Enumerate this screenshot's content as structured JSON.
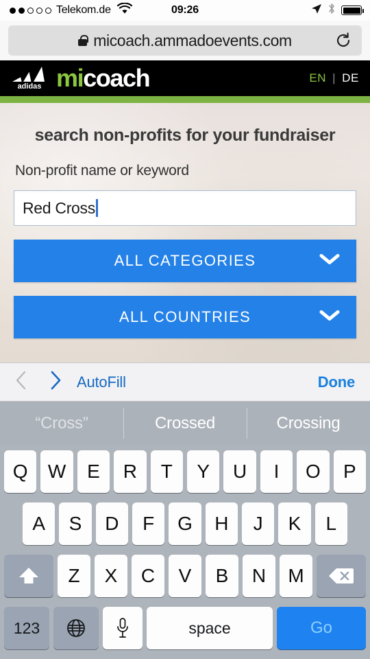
{
  "statusbar": {
    "carrier": "Telekom.de",
    "signal_dots_filled": 2,
    "signal_dots_total": 5,
    "wifi_icon": "wifi-icon",
    "time": "09:26",
    "location_icon": "location-arrow-icon",
    "bluetooth_icon": "bluetooth-icon",
    "battery_icon": "battery-full-icon",
    "battery_level": 100
  },
  "browser": {
    "lock_icon": "lock-icon",
    "url": "micoach.ammadoevents.com",
    "reload_icon": "reload-icon"
  },
  "site_header": {
    "logo_name": "adidas",
    "brand_mi": "mi",
    "brand_coach": "coach",
    "lang_en": "EN",
    "lang_separator": "|",
    "lang_de": "DE",
    "accent_green": "#8cc63f",
    "bar_green": "#7cb342"
  },
  "page": {
    "headline": "search non-profits for your fundraiser",
    "field_label": "Non-profit name or keyword",
    "search_value": "Red Cross",
    "search_placeholder": "Non-profit name or keyword",
    "dropdowns": [
      {
        "label": "ALL CATEGORIES",
        "chevron": "chevron-down-icon"
      },
      {
        "label": "ALL COUNTRIES",
        "chevron": "chevron-down-icon"
      }
    ],
    "button_blue": "#2481e8"
  },
  "accessory_bar": {
    "prev_icon": "chevron-left-icon",
    "next_icon": "chevron-right-icon",
    "autofill": "AutoFill",
    "done": "Done",
    "link_blue": "#1880e0"
  },
  "predictive": {
    "suggestions": [
      {
        "text": "“Cross”",
        "dim": true
      },
      {
        "text": "Crossed",
        "dim": false
      },
      {
        "text": "Crossing",
        "dim": false
      }
    ]
  },
  "keyboard": {
    "row1": [
      "Q",
      "W",
      "E",
      "R",
      "T",
      "Y",
      "U",
      "I",
      "O",
      "P"
    ],
    "row2": [
      "A",
      "S",
      "D",
      "F",
      "G",
      "H",
      "J",
      "K",
      "L"
    ],
    "row3": [
      "Z",
      "X",
      "C",
      "V",
      "B",
      "N",
      "M"
    ],
    "shift_icon": "shift-arrow-icon",
    "backspace_icon": "backspace-icon",
    "numbers_key": "123",
    "globe_icon": "globe-icon",
    "mic_icon": "microphone-icon",
    "space_key": "space",
    "go_key": "Go"
  }
}
